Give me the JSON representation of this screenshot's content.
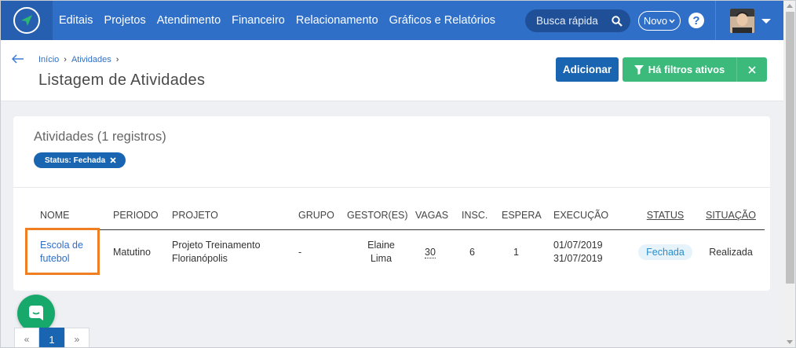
{
  "navbar": {
    "items": [
      "Editais",
      "Projetos",
      "Atendimento",
      "Financeiro",
      "Relacionamento",
      "Gráficos e Relatórios"
    ],
    "search_placeholder": "Busca rápida",
    "novo_label": "Novo",
    "help_label": "?"
  },
  "breadcrumb": [
    "Início",
    "Atividades"
  ],
  "page_title": "Listagem de Atividades",
  "buttons": {
    "add": "Adicionar",
    "filters": "Há filtros ativos"
  },
  "card": {
    "title": "Atividades (1 registros)",
    "chip_label": "Status: Fechada"
  },
  "table": {
    "headers": [
      "NOME",
      "PERIODO",
      "PROJETO",
      "GRUPO",
      "GESTOR(ES)",
      "VAGAS",
      "INSC.",
      "ESPERA",
      "EXECUÇÃO",
      "STATUS",
      "SITUAÇÃO"
    ],
    "row": {
      "nome_line1": "Escola de",
      "nome_line2": "futebol",
      "periodo": "Matutino",
      "projeto_line1": "Projeto Treinamento",
      "projeto_line2": "Florianópolis",
      "grupo": "-",
      "gestor_line1": "Elaine",
      "gestor_line2": "Lima",
      "vagas": "30",
      "insc": "6",
      "espera": "1",
      "execucao_start": "01/07/2019",
      "execucao_end": "31/07/2019",
      "status": "Fechada",
      "situacao": "Realizada"
    }
  },
  "pagination": {
    "prev": "«",
    "current": "1",
    "next": "»"
  },
  "colors": {
    "navbar": "#2f6fc8",
    "primary": "#1a65b2",
    "success": "#3cba7c",
    "highlight": "#f07e22",
    "chat": "#17a86b"
  }
}
